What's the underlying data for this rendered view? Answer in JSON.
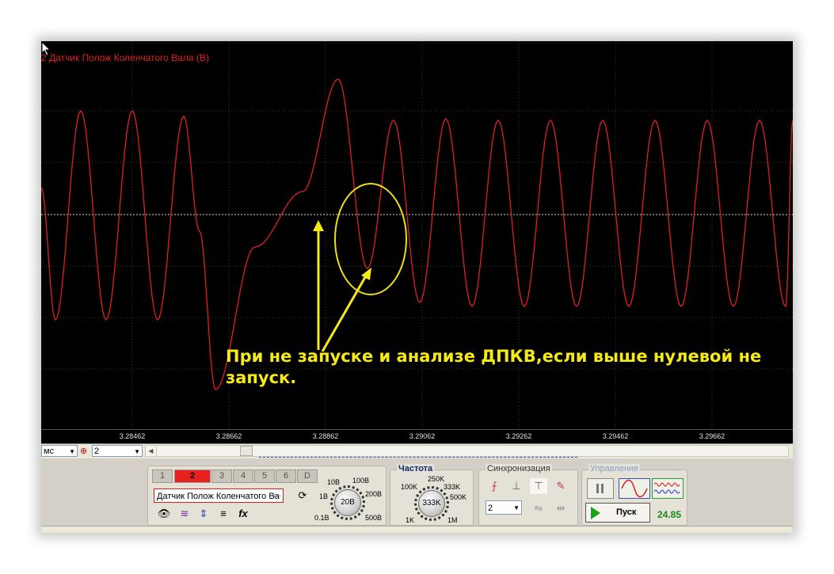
{
  "scope": {
    "channel_title": "2 Датчик Полож Коленчатого Вала (В)",
    "annotation_line1": "При не запуске и анализе ДПКВ,если выше нулевой не",
    "annotation_line2": "запуск.",
    "trace_color": "#e02020",
    "annotation_color": "#f5ea14"
  },
  "time_axis": {
    "ticks": [
      "3.28462",
      "3.28662",
      "3.28862",
      "3.29062",
      "3.29262",
      "3.29462",
      "3.29662"
    ]
  },
  "scroll_row": {
    "unit_value": "мс",
    "channel_value": "2"
  },
  "channels": {
    "tabs": [
      "1",
      "2",
      "3",
      "4",
      "5",
      "6",
      "D"
    ],
    "active_tab": "2",
    "sensor_value": "Датчик Полож Коленчатого Ва",
    "sensor_more": "···"
  },
  "range_knob": {
    "value": "20В",
    "labels": {
      "l1": "10В",
      "l2": "100В",
      "l3": "1В",
      "l4": "200В",
      "l5": "0.1В",
      "l6": "500В"
    }
  },
  "frequency": {
    "title": "Частота",
    "value": "333K",
    "labels": {
      "l1": "250K",
      "l2": "100K",
      "l3": "333K",
      "l4": "500K",
      "l5": "1K",
      "l6": "1M"
    }
  },
  "sync": {
    "title": "Синхронизация",
    "channel_value": "2"
  },
  "control": {
    "title": "Управление",
    "start_label": "Пуск",
    "readout": "24.85"
  },
  "icons": {
    "eye": "eye-icon",
    "wave": "waveform-icon",
    "updown": "up-down-arrows-icon",
    "lines": "lines-icon",
    "fx": "function-icon",
    "refresh": "refresh-icon",
    "pause": "pause-icon",
    "sine": "sine-wave-icon",
    "multi": "multi-wave-icon",
    "play": "play-icon"
  }
}
